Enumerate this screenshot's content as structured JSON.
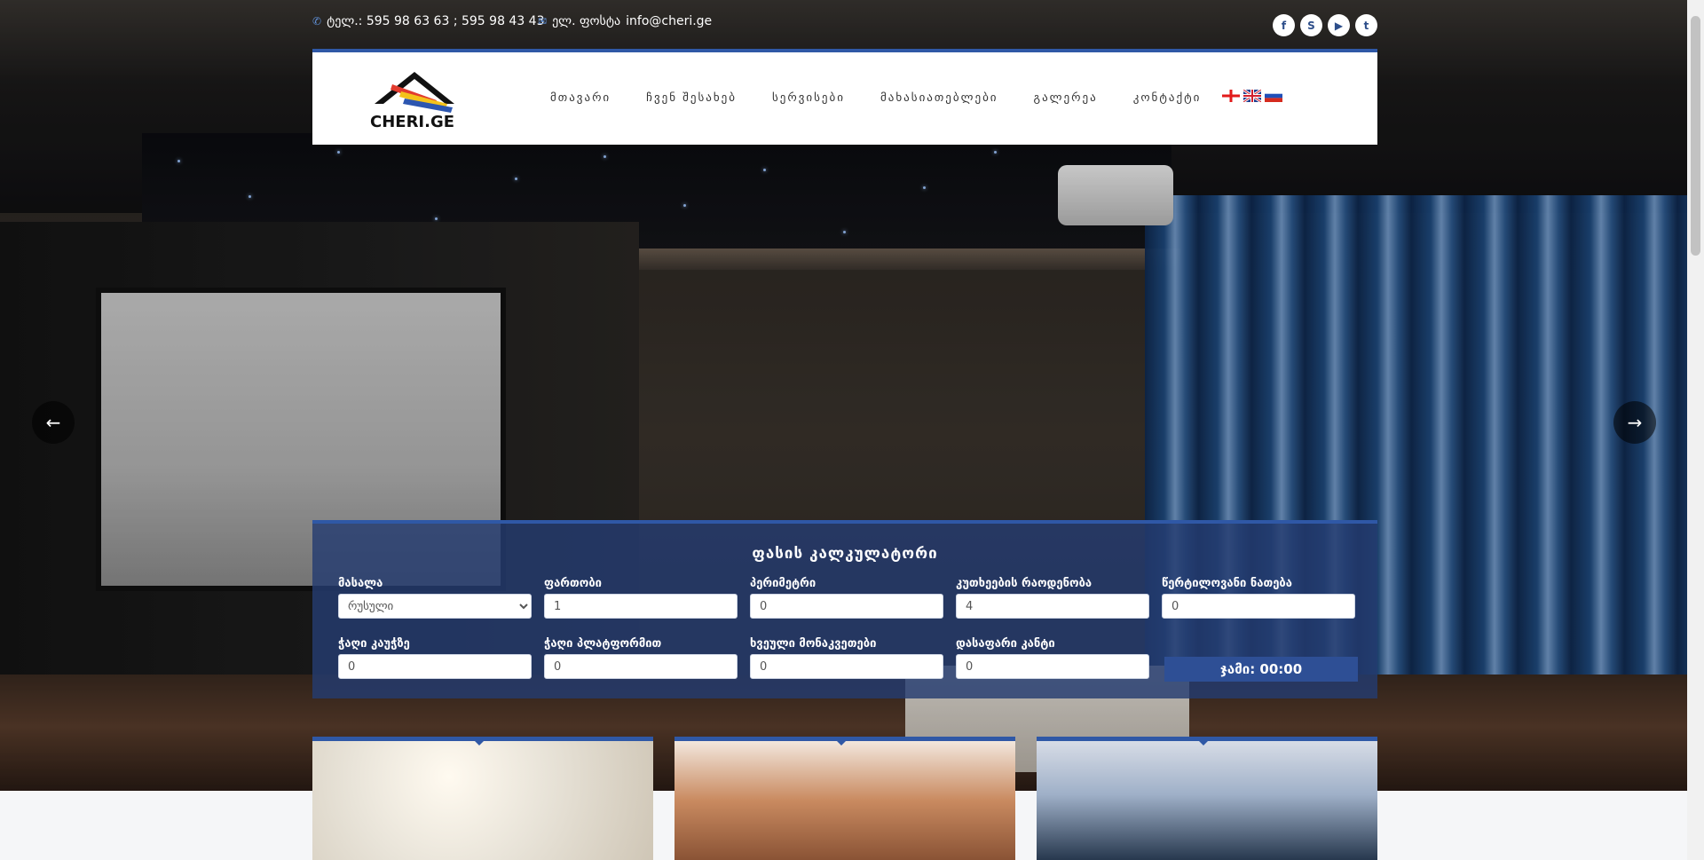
{
  "topbar": {
    "phone": "ტელ.: 595 98 63 63 ; 595 98 43 43",
    "email_label": "ელ. ფოსტა",
    "email": "info@cheri.ge",
    "socials": [
      "facebook-icon",
      "skype-icon",
      "youtube-icon",
      "twitter-icon"
    ]
  },
  "logo": {
    "text": "CHERI.GE"
  },
  "menu": [
    "მთავარი",
    "ჩვენ შესახებ",
    "სერვისები",
    "მახასიათებლები",
    "გალერეა",
    "კონტაქტი"
  ],
  "flags": [
    "ka",
    "en",
    "ru"
  ],
  "calculator": {
    "title": "ფასის კალკულატორი",
    "material_label": "მასალა",
    "material_value": "რუსული",
    "area_label": "ფართობი",
    "area_value": "1",
    "perimeter_label": "პერიმეტრი",
    "perimeter_value": "0",
    "corners_label": "კუთხეების რაოდენობა",
    "corners_value": "4",
    "spot_label": "წერტილოვანი ნათება",
    "spot_value": "0",
    "lamp_box_label": "ჭაღი კაუჭზე",
    "lamp_box_value": "0",
    "lamp_platform_label": "ჭაღი პლატფორმით",
    "lamp_platform_value": "0",
    "pipes_label": "ხვეული მონაკვეთები",
    "pipes_value": "0",
    "edge_label": "დასაფარი კანტი",
    "edge_value": "0",
    "total": "ჯამი: 00:00"
  },
  "colors": {
    "accent": "#2f58a6",
    "calc_bg": "#243c70"
  }
}
